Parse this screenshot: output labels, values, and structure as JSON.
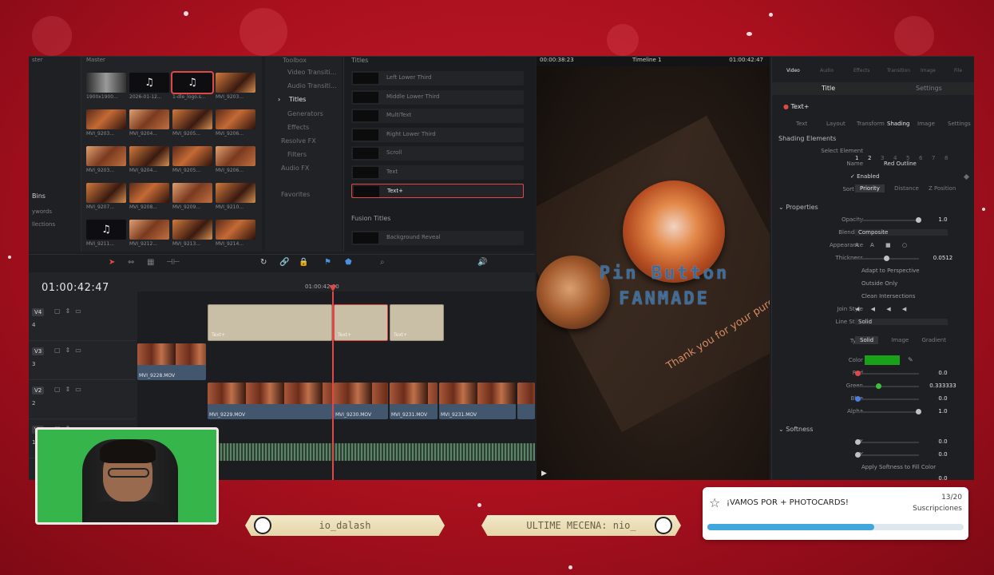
{
  "media_pool": {
    "header": "Master",
    "bins_header": "ster",
    "bins": [
      "Bins",
      "ywords",
      "llections"
    ],
    "clips": [
      {
        "name": "1900x1900...",
        "kind": "image"
      },
      {
        "name": "2026-01-12...",
        "kind": "audio"
      },
      {
        "name": "1-dle_logo.s...",
        "kind": "audio",
        "selected": true
      },
      {
        "name": "MVI_9203...",
        "kind": "video"
      },
      {
        "name": "MVI_9203...",
        "kind": "video"
      },
      {
        "name": "MVI_9204...",
        "kind": "video"
      },
      {
        "name": "MVI_9205...",
        "kind": "video"
      },
      {
        "name": "MVI_9206...",
        "kind": "video"
      },
      {
        "name": "MVI_9203...",
        "kind": "video"
      },
      {
        "name": "MVI_9204...",
        "kind": "video"
      },
      {
        "name": "MVI_9205...",
        "kind": "video"
      },
      {
        "name": "MVI_9206...",
        "kind": "video"
      },
      {
        "name": "MVI_9207...",
        "kind": "video"
      },
      {
        "name": "MVI_9208...",
        "kind": "video"
      },
      {
        "name": "MVI_9209...",
        "kind": "video"
      },
      {
        "name": "MVI_9210...",
        "kind": "video"
      },
      {
        "name": "MVI_9211...",
        "kind": "audio"
      },
      {
        "name": "MVI_9212...",
        "kind": "video"
      },
      {
        "name": "MVI_9213...",
        "kind": "video"
      },
      {
        "name": "MVI_9214...",
        "kind": "video"
      },
      {
        "name": "",
        "kind": "video"
      },
      {
        "name": "",
        "kind": "video"
      },
      {
        "name": "",
        "kind": "video"
      },
      {
        "name": "",
        "kind": "video"
      }
    ]
  },
  "effects": {
    "toolbox": "Toolbox",
    "items": [
      "Video Transiti...",
      "Audio Transiti...",
      "Titles",
      "Generators",
      "Effects",
      "Resolve FX",
      "Filters",
      "Audio FX",
      "Favorites"
    ]
  },
  "titles": {
    "header": "Titles",
    "items": [
      "Left Lower Third",
      "Middle Lower Third",
      "MultiText",
      "Right Lower Third",
      "Scroll",
      "Text",
      "Text+"
    ],
    "fusion_header": "Fusion Titles",
    "fusion_items": [
      "Background Reveal"
    ]
  },
  "viewer": {
    "timecode_left": "00:00:38:23",
    "timeline_name": "Timeline 1",
    "timecode_right": "01:00:42:47",
    "overlay_title": "Pin Button",
    "overlay_subtitle": "FANMADE",
    "overlay_thanks": "Thank you for your purchase"
  },
  "inspector": {
    "top_tabs": [
      "Video",
      "Audio",
      "Effects",
      "Transition",
      "Image",
      "File"
    ],
    "sub_tabs": [
      "Title",
      "Settings"
    ],
    "tool_name": "Text+",
    "tool_tabs": [
      "Text",
      "Layout",
      "Transform",
      "Shading",
      "Image",
      "Settings"
    ],
    "shading_elements_label": "Shading Elements",
    "select_element_label": "Select Element",
    "elements": [
      "1",
      "2",
      "3",
      "4",
      "5",
      "6",
      "7",
      "8"
    ],
    "name_label": "Name",
    "name_value": "Red Outline",
    "enabled_label": "Enabled",
    "sort_by_label": "Sort By",
    "sort_options": [
      "Priority",
      "Distance",
      "Z Position"
    ],
    "properties_label": "Properties",
    "opacity_label": "Opacity",
    "opacity_value": "1.0",
    "blending_label": "Blending",
    "blending_value": "Composite",
    "appearance_label": "Appearance",
    "thickness_label": "Thickness",
    "thickness_value": "0.0512",
    "adapt_label": "Adapt to Perspective",
    "outside_label": "Outside Only",
    "clean_label": "Clean Intersections",
    "join_label": "Join Style",
    "line_label": "Line Style",
    "line_value": "Solid",
    "type_label": "Type",
    "type_options": [
      "Solid",
      "Image",
      "Gradient"
    ],
    "color_label": "Color",
    "color_hex": "#1aa11a",
    "red_label": "Red",
    "red_value": "0.0",
    "green_label": "Green",
    "green_value": "0.333333",
    "blue_label": "Blue",
    "blue_value": "0.0",
    "alpha_label": "Alpha",
    "alpha_value": "1.0",
    "softness_label": "Softness",
    "x_label": "X",
    "x_value": "0.0",
    "y_label": "Y",
    "y_value": "0.0",
    "apply_label": "Apply Softness to Fill Color",
    "last_value": "0.0"
  },
  "timeline": {
    "timecode": "01:00:42:47",
    "ruler_label": "01:00:42:00",
    "tracks": [
      {
        "name": "V4",
        "num": "4"
      },
      {
        "name": "V3",
        "num": "3"
      },
      {
        "name": "V2",
        "num": "2"
      },
      {
        "name": "V1",
        "num": "1"
      }
    ],
    "title_clips": [
      "Text+",
      "Text+",
      "Text+"
    ],
    "v3_clip": "MVI_9228.MOV",
    "v2_clips": [
      "MVI_9229.MOV",
      "MVI_9230.MOV",
      "MVI_9231.MOV",
      "MVI_9231.MOV"
    ]
  },
  "stream": {
    "banner_left": "io_dalash",
    "banner_right": "ULTIME MECENA: nio_",
    "goal_title": "¡VAMOS POR + PHOTOCARDS!",
    "goal_count": "13/20",
    "goal_label": "Suscripciones",
    "goal_progress": 0.65
  }
}
